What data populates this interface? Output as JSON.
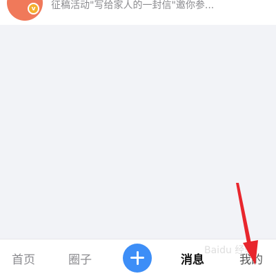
{
  "message_list": {
    "item": {
      "badge": "v",
      "preview": "征稿活动\"写给家人的一封信\"邀你参..."
    }
  },
  "tab_bar": {
    "home_label": "首页",
    "circle_label": "圈子",
    "message_label": "消息",
    "mine_label": "我的",
    "active": "消息"
  },
  "watermark": "Baidu 经验",
  "colors": {
    "accent": "#3d8ef7",
    "avatar": "#f0795a",
    "badge": "#f4b02e",
    "arrow": "#e8262d"
  },
  "icons": {
    "add": "plus-icon"
  }
}
